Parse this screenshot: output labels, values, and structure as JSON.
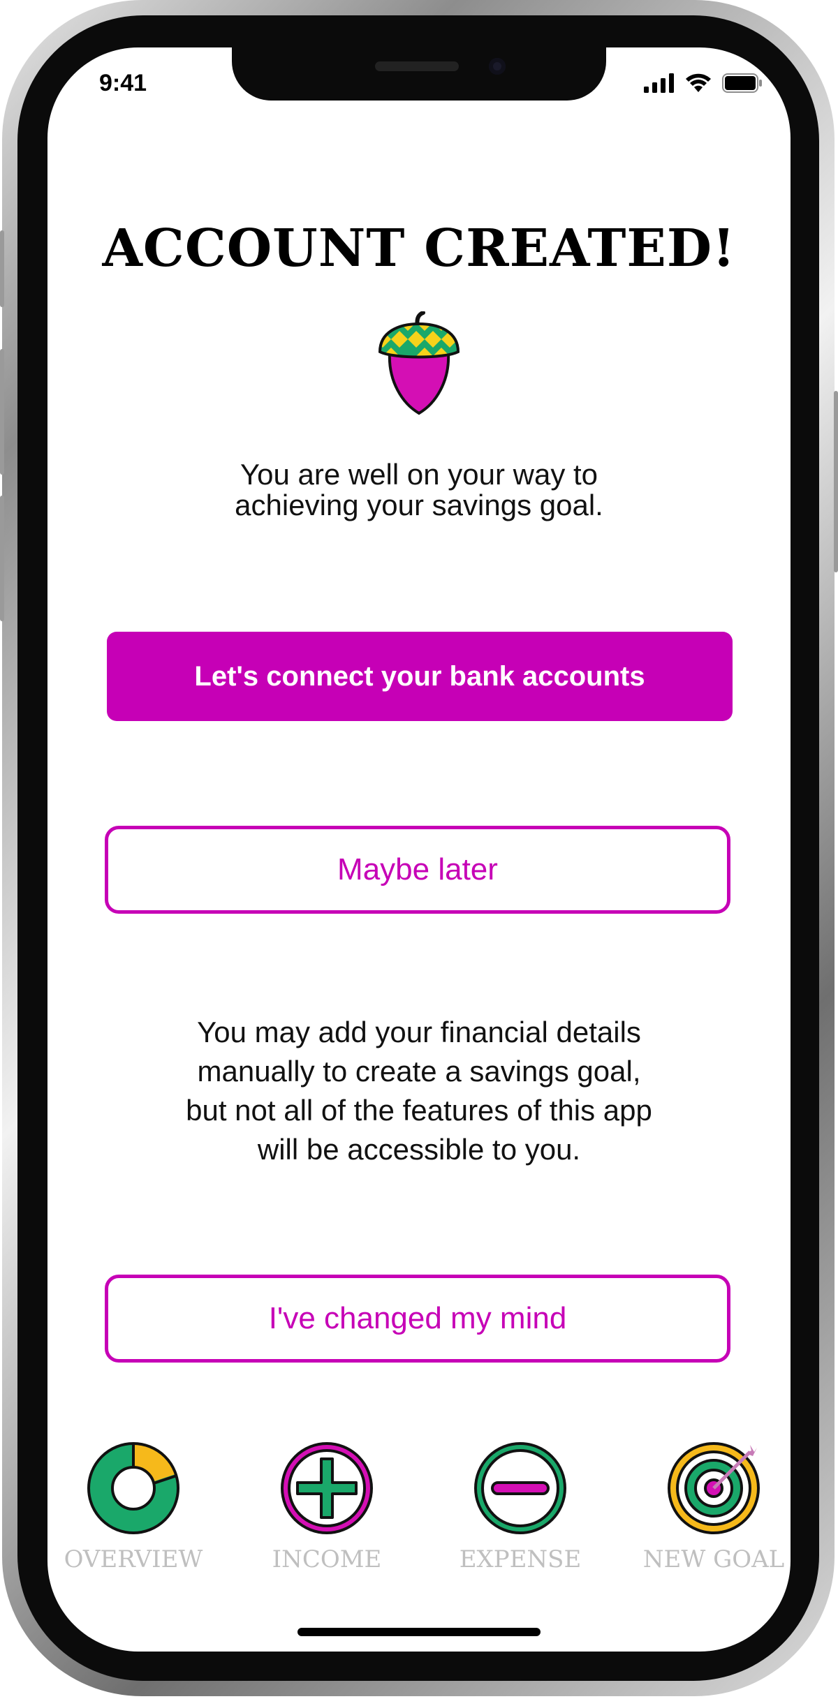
{
  "status_bar": {
    "time": "9:41",
    "icons": [
      "cellular-signal-icon",
      "wifi-icon",
      "battery-icon"
    ]
  },
  "page": {
    "title": "ACCOUNT CREATED!",
    "logo": "acorn-icon",
    "intro_line1": "You are well on your way to",
    "intro_line2": "achieving your savings goal.",
    "connect_button": "Let's connect your bank accounts",
    "maybe_later_button": "Maybe later",
    "info_line1": "You may add your financial details",
    "info_line2": "manually to create a savings goal,",
    "info_line3": "but not all of the features of this app",
    "info_line4": "will be accessible to you.",
    "changed_mind_button": "I've changed my mind"
  },
  "tab_bar": {
    "overview": {
      "label": "OVERVIEW",
      "icon": "donut-chart-icon"
    },
    "income": {
      "label": "INCOME",
      "icon": "plus-circle-icon"
    },
    "expense": {
      "label": "EXPENSE",
      "icon": "minus-circle-icon"
    },
    "new_goal": {
      "label": "NEW GOAL",
      "icon": "target-arrow-icon"
    }
  },
  "colors": {
    "accent_magenta": "#c600b6",
    "green": "#1aa86a",
    "yellow": "#f6b91b",
    "tab_label_gray": "#bfbfbf"
  }
}
